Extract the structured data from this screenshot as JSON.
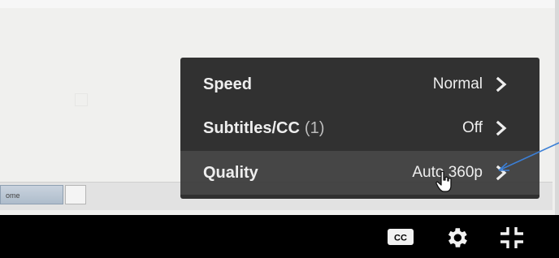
{
  "settings_menu": {
    "items": [
      {
        "label": "Speed",
        "count": "",
        "value": "Normal"
      },
      {
        "label": "Subtitles/CC",
        "count": "(1)",
        "value": "Off"
      },
      {
        "label": "Quality",
        "count": "",
        "value": "Auto 360p"
      }
    ],
    "highlighted_item": "Quality"
  },
  "background": {
    "tab_label": "ome"
  },
  "controls": {
    "icons": [
      "closed-captions-icon",
      "settings-gear-icon",
      "exit-fullscreen-icon"
    ]
  },
  "colors": {
    "menu_bg": "#212121",
    "menu_text": "#eeeeee",
    "annotation_arrow": "#3b7fd6",
    "controls_bar": "#000000"
  }
}
